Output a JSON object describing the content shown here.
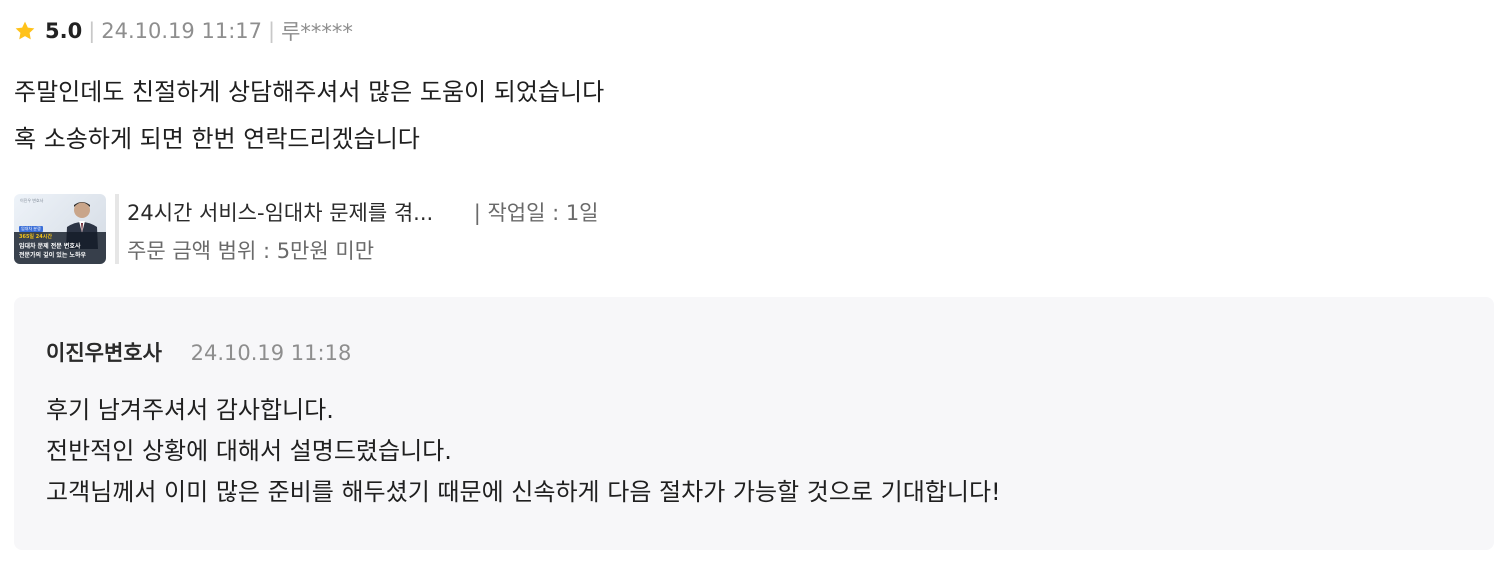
{
  "review": {
    "rating": "5.0",
    "date": "24.10.19 11:17",
    "author": "루*****",
    "separator": "|",
    "star_color": "#FFC21A",
    "star_icon": "star-icon",
    "body_lines": [
      "주말인데도 친절하게 상담해주셔서 많은 도움이 되었습니다",
      "혹 소송하게 되면 한번 연락드리겠습니다"
    ]
  },
  "service": {
    "title": "24시간 서비스-임대차 문제를 겪...",
    "workday": "| 작업일 : 1일",
    "price_range": "주문 금액 범위 : 5만원 미만",
    "thumbnail": {
      "label": "이진우 변호사",
      "tag": "임대차 분쟁",
      "highlight": "365일 24시간",
      "line1": "임대차 문제 전문 변호사",
      "line2": "전문가의 깊이 있는 노하우"
    }
  },
  "reply": {
    "name": "이진우변호사",
    "date": "24.10.19 11:18",
    "lines": [
      "후기 남겨주셔서 감사합니다.",
      "전반적인 상황에 대해서 설명드렸습니다.",
      "고객님께서 이미 많은 준비를 해두셨기 때문에 신속하게 다음 절차가 가능할 것으로 기대합니다!"
    ]
  }
}
